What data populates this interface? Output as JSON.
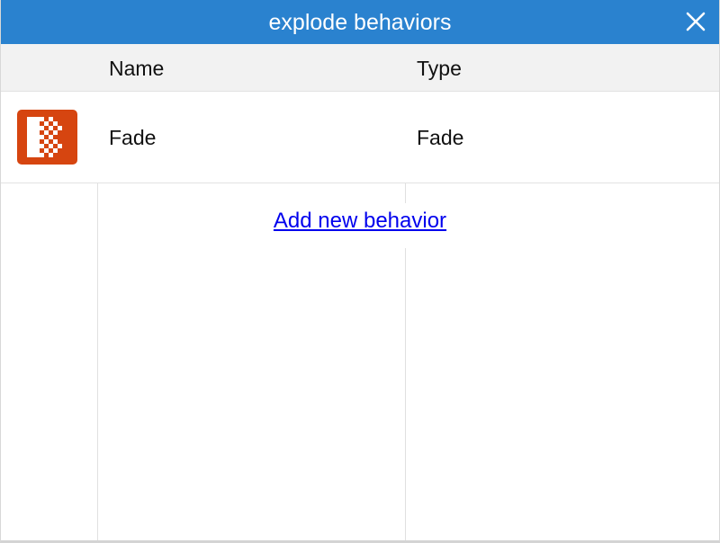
{
  "window": {
    "title": "explode behaviors"
  },
  "table": {
    "columns": [
      "Name",
      "Type"
    ],
    "rows": [
      {
        "icon": "fade-behavior-icon",
        "name": "Fade",
        "type": "Fade"
      }
    ]
  },
  "actions": {
    "add_label": "Add new behavior"
  },
  "colors": {
    "titlebar": "#2a82cf",
    "header_bg": "#f2f2f2",
    "icon_bg": "#d64510",
    "link": "#0000ee"
  }
}
